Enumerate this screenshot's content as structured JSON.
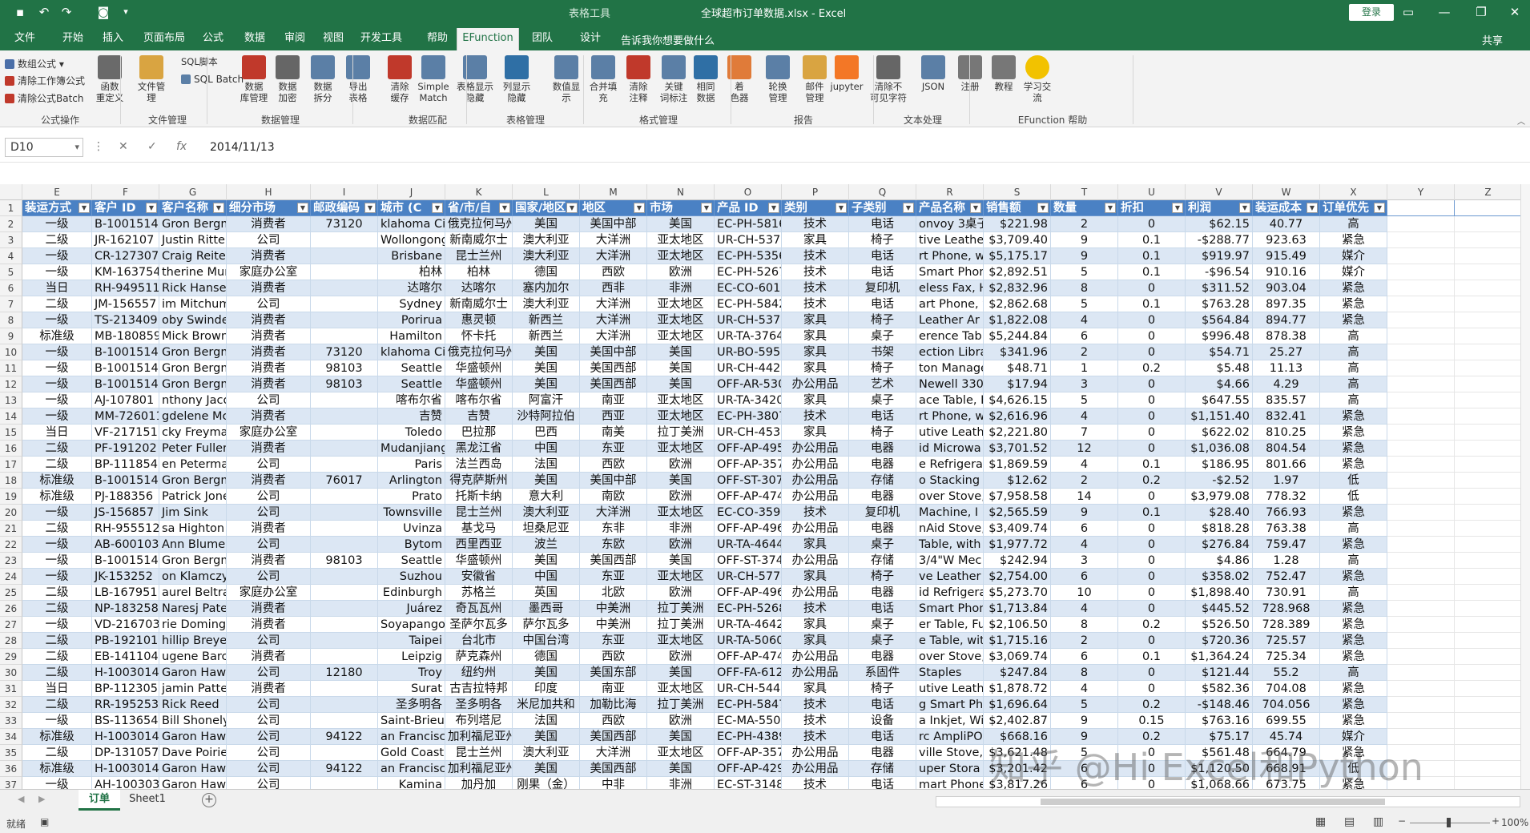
{
  "window": {
    "title": "全球超市订单数据.xlsx - Excel",
    "context_tab": "表格工具",
    "login": "登录",
    "share": "共享",
    "tell_me": "告诉我你想要做什么"
  },
  "tabs": [
    "文件",
    "开始",
    "插入",
    "页面布局",
    "公式",
    "数据",
    "审阅",
    "视图",
    "开发工具",
    "帮助",
    "EFunction",
    "团队",
    "设计"
  ],
  "ribbon": {
    "small_buttons": [
      "数组公式",
      "清除工作簿公式",
      "清除公式Batch",
      "SQL脚本",
      "SQL Batch"
    ],
    "buttons": [
      {
        "label": "函数\n重定义",
        "color": "#6a6a6a"
      },
      {
        "label": "文件管\n理",
        "color": "#d9a441"
      },
      {
        "label": "数据\n库管理",
        "color": "#c0392b"
      },
      {
        "label": "数据\n加密",
        "color": "#666666"
      },
      {
        "label": "数据\n拆分",
        "color": "#5b7fa6"
      },
      {
        "label": "导出\n表格",
        "color": "#5b7fa6"
      },
      {
        "label": "清除\n缓存",
        "color": "#c0392b"
      },
      {
        "label": "Simple\nMatch",
        "color": "#5b7fa6"
      },
      {
        "label": "表格显示\n隐藏",
        "color": "#5b7fa6"
      },
      {
        "label": "列显示\n隐藏",
        "color": "#2f6fa5"
      },
      {
        "label": "数值显\n示",
        "color": "#5b7fa6"
      },
      {
        "label": "合并填\n充",
        "color": "#5b7fa6"
      },
      {
        "label": "清除\n注释",
        "color": "#c0392b"
      },
      {
        "label": "关键\n词标注",
        "color": "#5b7fa6"
      },
      {
        "label": "相同\n数据",
        "color": "#2f6fa5"
      },
      {
        "label": "着\n色器",
        "color": "#e07b39"
      },
      {
        "label": "轮换\n管理",
        "color": "#5b7fa6"
      },
      {
        "label": "邮件\n管理",
        "color": "#d9a441"
      },
      {
        "label": "jupyter",
        "color": "#f37726"
      },
      {
        "label": "清除不\n可见字符",
        "color": "#666666"
      },
      {
        "label": "JSON",
        "color": "#5b7fa6"
      },
      {
        "label": "注册",
        "color": "#777777"
      },
      {
        "label": "教程",
        "color": "#777777"
      },
      {
        "label": "学习交\n流",
        "color": "#f2c200"
      }
    ],
    "groups": [
      "公式操作",
      "文件管理",
      "数据管理",
      "数据匹配",
      "表格管理",
      "格式管理",
      "报告",
      "文本处理",
      "EFunction 帮助"
    ]
  },
  "formula_bar": {
    "name_box": "D10",
    "formula": "2014/11/13"
  },
  "columns": [
    "E",
    "F",
    "G",
    "H",
    "I",
    "J",
    "K",
    "L",
    "M",
    "N",
    "O",
    "P",
    "Q",
    "R",
    "S",
    "T",
    "U",
    "V",
    "W",
    "X",
    "Y",
    "Z"
  ],
  "headers": [
    "装运方式",
    "客户 ID",
    "客户名称",
    "细分市场",
    "邮政编码",
    "城市 (C",
    "省/市/自",
    "国家/地区",
    "地区",
    "市场",
    "产品 ID",
    "类别",
    "子类别",
    "产品名称",
    "销售额",
    "数量",
    "折扣",
    "利润",
    "装运成本",
    "订单优先"
  ],
  "rows": [
    [
      "一级",
      "B-1001514",
      "Gron Bergm",
      "消费者",
      "73120",
      "klahoma Ci",
      "俄克拉何马州",
      "美国",
      "美国中部",
      "美国",
      "EC-PH-5816",
      "技术",
      "电话",
      "onvoy 3桌子",
      "$221.98",
      "2",
      "0",
      "$62.15",
      "40.77",
      "高"
    ],
    [
      "二级",
      "JR-162107",
      "Justin Ritter",
      "公司",
      "",
      "Wollongong",
      "新南威尔士",
      "澳大利亚",
      "大洋洲",
      "亚太地区",
      "UR-CH-537",
      "家具",
      "椅子",
      "tive Leather",
      "$3,709.40",
      "9",
      "0.1",
      "-$288.77",
      "923.63",
      "紧急"
    ],
    [
      "一级",
      "CR-127307",
      "Craig Reiter",
      "消费者",
      "",
      "Brisbane",
      "昆士兰州",
      "澳大利亚",
      "大洋洲",
      "亚太地区",
      "EC-PH-5356",
      "技术",
      "电话",
      "rt Phone, wi",
      "$5,175.17",
      "9",
      "0.1",
      "$919.97",
      "915.49",
      "媒介"
    ],
    [
      "一级",
      "KM-163754",
      "therine Mur",
      "家庭办公室",
      "",
      "柏林",
      "柏林",
      "德国",
      "西欧",
      "欧洲",
      "EC-PH-5267",
      "技术",
      "电话",
      "Smart Phone",
      "$2,892.51",
      "5",
      "0.1",
      "-$96.54",
      "910.16",
      "媒介"
    ],
    [
      "当日",
      "RH-949511",
      "Rick Hansen",
      "消费者",
      "",
      "达喀尔",
      "达喀尔",
      "塞内加尔",
      "西非",
      "非洲",
      "EC-CO-601",
      "技术",
      "复印机",
      "eless Fax, Hi",
      "$2,832.96",
      "8",
      "0",
      "$311.52",
      "903.04",
      "紧急"
    ],
    [
      "二级",
      "JM-156557",
      "im Mitchum",
      "公司",
      "",
      "Sydney",
      "新南威尔士",
      "澳大利亚",
      "大洋洲",
      "亚太地区",
      "EC-PH-5842",
      "技术",
      "电话",
      "art Phone, w",
      "$2,862.68",
      "5",
      "0.1",
      "$763.28",
      "897.35",
      "紧急"
    ],
    [
      "一级",
      "TS-213409",
      "oby Swinde",
      "消费者",
      "",
      "Porirua",
      "惠灵顿",
      "新西兰",
      "大洋洲",
      "亚太地区",
      "UR-CH-537",
      "家具",
      "椅子",
      "Leather Ar",
      "$1,822.08",
      "4",
      "0",
      "$564.84",
      "894.77",
      "紧急"
    ],
    [
      "标准级",
      "MB-180859",
      "Mick Brown",
      "消费者",
      "",
      "Hamilton",
      "怀卡托",
      "新西兰",
      "大洋洲",
      "亚太地区",
      "UR-TA-3764",
      "家具",
      "桌子",
      "erence Table",
      "$5,244.84",
      "6",
      "0",
      "$996.48",
      "878.38",
      "高"
    ],
    [
      "一级",
      "B-1001514",
      "Gron Bergm",
      "消费者",
      "73120",
      "klahoma Ci",
      "俄克拉何马州",
      "美国",
      "美国中部",
      "美国",
      "UR-BO-5957",
      "家具",
      "书架",
      "ection Libra",
      "$341.96",
      "2",
      "0",
      "$54.71",
      "25.27",
      "高"
    ],
    [
      "一级",
      "B-1001514",
      "Gron Bergm",
      "消费者",
      "98103",
      "Seattle",
      "华盛顿州",
      "美国",
      "美国西部",
      "美国",
      "UR-CH-442",
      "家具",
      "椅子",
      "ton Manage",
      "$48.71",
      "1",
      "0.2",
      "$5.48",
      "11.13",
      "高"
    ],
    [
      "一级",
      "B-1001514",
      "Gron Bergm",
      "消费者",
      "98103",
      "Seattle",
      "华盛顿州",
      "美国",
      "美国西部",
      "美国",
      "OFF-AR-5309",
      "办公用品",
      "艺术",
      "Newell 330",
      "$17.94",
      "3",
      "0",
      "$4.66",
      "4.29",
      "高"
    ],
    [
      "一级",
      "AJ-107801",
      "nthony Jaco",
      "公司",
      "",
      "喀布尔省",
      "喀布尔省",
      "阿富汗",
      "南亚",
      "亚太地区",
      "UR-TA-3420",
      "家具",
      "桌子",
      "ace Table, Fu",
      "$4,626.15",
      "5",
      "0",
      "$647.55",
      "835.57",
      "高"
    ],
    [
      "一级",
      "MM-726011",
      "gdelene Mc",
      "消费者",
      "",
      "吉赞",
      "吉赞",
      "沙特阿拉伯",
      "西亚",
      "亚太地区",
      "EC-PH-3807",
      "技术",
      "电话",
      "rt Phone, wi",
      "$2,616.96",
      "4",
      "0",
      "$1,151.40",
      "832.41",
      "紧急"
    ],
    [
      "当日",
      "VF-217151",
      "cky Freymar",
      "家庭办公室",
      "",
      "Toledo",
      "巴拉那",
      "巴西",
      "南美",
      "拉丁美洲",
      "UR-CH-453",
      "家具",
      "椅子",
      "utive Leath",
      "$2,221.80",
      "7",
      "0",
      "$622.02",
      "810.25",
      "紧急"
    ],
    [
      "二级",
      "PF-191202",
      "Peter Fuller",
      "消费者",
      "",
      "Mudanjiang",
      "黑龙江省",
      "中国",
      "东亚",
      "亚太地区",
      "OFF-AP-4959",
      "办公用品",
      "电器",
      "id Microwa",
      "$3,701.52",
      "12",
      "0",
      "$1,036.08",
      "804.54",
      "紧急"
    ],
    [
      "二级",
      "BP-111854",
      "en Peterma",
      "公司",
      "",
      "Paris",
      "法兰西岛",
      "法国",
      "西欧",
      "欧洲",
      "OFF-AP-3575",
      "办公用品",
      "电器",
      "e Refrigerate",
      "$1,869.59",
      "4",
      "0.1",
      "$186.95",
      "801.66",
      "紧急"
    ],
    [
      "标准级",
      "B-1001514",
      "Gron Bergm",
      "消费者",
      "76017",
      "Arlington",
      "得克萨斯州",
      "美国",
      "美国中部",
      "美国",
      "OFF-ST-3078",
      "办公用品",
      "存储",
      "o Stacking I",
      "$12.62",
      "2",
      "0.2",
      "-$2.52",
      "1.97",
      "低"
    ],
    [
      "标准级",
      "PJ-188356",
      "Patrick Jones",
      "公司",
      "",
      "Prato",
      "托斯卡纳",
      "意大利",
      "南欧",
      "欧洲",
      "OFF-AP-4743",
      "办公用品",
      "电器",
      "over Stove, I",
      "$7,958.58",
      "14",
      "0",
      "$3,979.08",
      "778.32",
      "低"
    ],
    [
      "一级",
      "JS-156857",
      "Jim Sink",
      "公司",
      "",
      "Townsville",
      "昆士兰州",
      "澳大利亚",
      "大洋洲",
      "亚太地区",
      "EC-CO-3597",
      "技术",
      "复印机",
      "Machine, I",
      "$2,565.59",
      "9",
      "0.1",
      "$28.40",
      "766.93",
      "紧急"
    ],
    [
      "二级",
      "RH-955512",
      "sa Highton",
      "消费者",
      "",
      "Uvinza",
      "基戈马",
      "坦桑尼亚",
      "东非",
      "非洲",
      "OFF-AP-4967",
      "办公用品",
      "电器",
      "nAid Stove,",
      "$3,409.74",
      "6",
      "0",
      "$818.28",
      "763.38",
      "高"
    ],
    [
      "一级",
      "AB-600103",
      "Ann Blume",
      "公司",
      "",
      "Bytom",
      "西里西亚",
      "波兰",
      "东欧",
      "欧洲",
      "UR-TA-4644",
      "家具",
      "桌子",
      "Table, with I",
      "$1,977.72",
      "4",
      "0",
      "$276.84",
      "759.47",
      "紧急"
    ],
    [
      "一级",
      "B-1001514",
      "Gron Bergm",
      "消费者",
      "98103",
      "Seattle",
      "华盛顿州",
      "美国",
      "美国西部",
      "美国",
      "OFF-ST-3744",
      "办公用品",
      "存储",
      "3/4\"W Mec",
      "$242.94",
      "3",
      "0",
      "$4.86",
      "1.28",
      "高"
    ],
    [
      "一级",
      "JK-153252",
      "on Klamczyr",
      "公司",
      "",
      "Suzhou",
      "安徽省",
      "中国",
      "东亚",
      "亚太地区",
      "UR-CH-5774",
      "家具",
      "椅子",
      "ve Leather A",
      "$2,754.00",
      "6",
      "0",
      "$358.02",
      "752.47",
      "紧急"
    ],
    [
      "二级",
      "LB-167951",
      "aurel Beltra",
      "家庭办公室",
      "",
      "Edinburgh",
      "苏格兰",
      "英国",
      "北欧",
      "欧洲",
      "OFF-AP-4960",
      "办公用品",
      "电器",
      "id Refrigera",
      "$5,273.70",
      "10",
      "0",
      "$1,898.40",
      "730.91",
      "高"
    ],
    [
      "二级",
      "NP-183258",
      "Naresj Patel",
      "消费者",
      "",
      "Juárez",
      "奇瓦瓦州",
      "墨西哥",
      "中美洲",
      "拉丁美洲",
      "EC-PH-5268",
      "技术",
      "电话",
      "Smart Phon",
      "$1,713.84",
      "4",
      "0",
      "$445.52",
      "728.968",
      "紧急"
    ],
    [
      "一级",
      "VD-216703",
      "rie Doming",
      "消费者",
      "",
      "Soyapango",
      "圣萨尔瓦多",
      "萨尔瓦多",
      "中美洲",
      "拉丁美洲",
      "UR-TA-4642",
      "家具",
      "桌子",
      "er Table, Ful",
      "$2,106.50",
      "8",
      "0.2",
      "$526.50",
      "728.389",
      "紧急"
    ],
    [
      "二级",
      "PB-192101",
      "hillip Breye",
      "公司",
      "",
      "Taipei",
      "台北市",
      "中国台湾",
      "东亚",
      "亚太地区",
      "UR-TA-5060",
      "家具",
      "桌子",
      "e Table, with",
      "$1,715.16",
      "2",
      "0",
      "$720.36",
      "725.57",
      "紧急"
    ],
    [
      "二级",
      "EB-141104",
      "ugene Barch",
      "消费者",
      "",
      "Leipzig",
      "萨克森州",
      "德国",
      "西欧",
      "欧洲",
      "OFF-AP-4743",
      "办公用品",
      "电器",
      "over Stove, I",
      "$3,069.74",
      "6",
      "0.1",
      "$1,364.24",
      "725.34",
      "紧急"
    ],
    [
      "二级",
      "H-1003014",
      "Garon Hawkir",
      "公司",
      "12180",
      "Troy",
      "纽约州",
      "美国",
      "美国东部",
      "美国",
      "OFF-FA-6129",
      "办公用品",
      "系固件",
      "Staples",
      "$247.84",
      "8",
      "0",
      "$121.44",
      "55.2",
      "高"
    ],
    [
      "当日",
      "BP-112305",
      "jamin Patter",
      "消费者",
      "",
      "Surat",
      "古吉拉特邦",
      "印度",
      "南亚",
      "亚太地区",
      "UR-CH-544",
      "家具",
      "椅子",
      "utive Leathe",
      "$1,878.72",
      "4",
      "0",
      "$582.36",
      "704.08",
      "紧急"
    ],
    [
      "二级",
      "RR-195253",
      "Rick Reed",
      "公司",
      "",
      "圣多明各",
      "圣多明各",
      "米尼加共和",
      "加勒比海",
      "拉丁美洲",
      "EC-PH-5847",
      "技术",
      "电话",
      "g Smart Pho",
      "$1,696.64",
      "5",
      "0.2",
      "-$148.46",
      "704.056",
      "紧急"
    ],
    [
      "一级",
      "BS-113654",
      "Bill Shonely",
      "公司",
      "",
      "Saint-Brieuc",
      "布列塔尼",
      "法国",
      "西欧",
      "欧洲",
      "EC-MA-550",
      "技术",
      "设备",
      "a Inkjet, Wi",
      "$2,402.87",
      "9",
      "0.15",
      "$763.16",
      "699.55",
      "紧急"
    ],
    [
      "标准级",
      "H-1003014",
      "Garon Hawkir",
      "公司",
      "94122",
      "an Francisco",
      "加利福尼亚州",
      "美国",
      "美国西部",
      "美国",
      "EC-PH-4389",
      "技术",
      "电话",
      "rc AmpliPO",
      "$668.16",
      "9",
      "0.2",
      "$75.17",
      "45.74",
      "媒介"
    ],
    [
      "二级",
      "DP-131057",
      "Dave Poirier",
      "公司",
      "",
      "Gold Coast",
      "昆士兰州",
      "澳大利亚",
      "大洋洲",
      "亚太地区",
      "OFF-AP-3575",
      "办公用品",
      "电器",
      "ville Stove,",
      "$3,621.48",
      "5",
      "0",
      "$561.48",
      "664.79",
      "紧急"
    ],
    [
      "标准级",
      "H-1003014",
      "Garon Hawkir",
      "公司",
      "94122",
      "an Francisco",
      "加利福尼亚州",
      "美国",
      "美国西部",
      "美国",
      "OFF-AP-4297",
      "办公用品",
      "存储",
      "uper Stora",
      "$3,201.42",
      "6",
      "0",
      "$1,120.50",
      "668.91",
      "低"
    ],
    [
      "一级",
      "AH-100303",
      "Garon Hawkir",
      "公司",
      "",
      "Kamina",
      "加丹加",
      "刚果（金）",
      "中非",
      "非洲",
      "EC-ST-3148",
      "技术",
      "电话",
      "mart Phone,",
      "$3,817.26",
      "6",
      "0",
      "$1,068.66",
      "673.75",
      "紧急"
    ]
  ],
  "sheet_tabs": [
    "订单",
    "Sheet1"
  ],
  "status": {
    "ready": "就绪",
    "zoom": "100%"
  },
  "watermark": "知乎 @Hi Excel和Python",
  "colors": {
    "brand": "#217346",
    "header": "#4a81c4",
    "band": "#dce7f4"
  }
}
